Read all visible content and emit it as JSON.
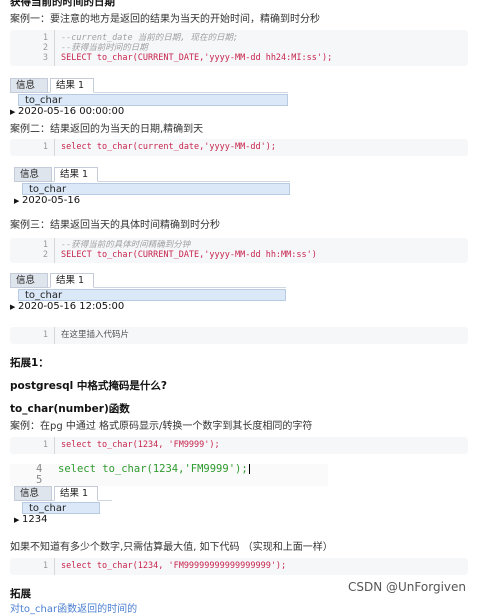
{
  "heading_top": "获得当前的时间的日期",
  "case1_text": "案例一：要注意的地方是返回的结果为当天的开始时间，精确到时分秒",
  "code1": {
    "lines": [
      {
        "n": "1",
        "text": "--current_date 当前的日期, 现在的日期;",
        "kind": "cmt"
      },
      {
        "n": "2",
        "text": "--获得当前时间的日期",
        "kind": "cmt"
      },
      {
        "n": "3",
        "text": "SELECT to_char(CURRENT_DATE,'yyyy-MM-dd hh24:MI:ss');",
        "kind": "src"
      }
    ]
  },
  "result1": {
    "tab_info": "信息",
    "tab_result": "结果 1",
    "column": "to_char",
    "value": "2020-05-16 00:00:00"
  },
  "case2_text": "案例二：结果返回的为当天的日期,精确到天",
  "code2": {
    "lines": [
      {
        "n": "1",
        "text": "select to_char(current_date,'yyyy-MM-dd');",
        "kind": "src"
      }
    ]
  },
  "result2": {
    "tab_info": "信息",
    "tab_result": "结果 1",
    "column": "to_char",
    "value": "2020-05-16"
  },
  "case3_text": "案例三：结果返回当天的具体时间精确到时分秒",
  "code3": {
    "lines": [
      {
        "n": "1",
        "text": "--获得当前的具体时间精确到分钟",
        "kind": "cmt"
      },
      {
        "n": "2",
        "text": "SELECT to_char(CURRENT_DATE,'yyyy-MM-dd hh:MM:ss')",
        "kind": "src"
      }
    ]
  },
  "result3": {
    "tab_info": "信息",
    "tab_result": "结果 1",
    "column": "to_char",
    "value": "2020-05-16 12:05:00"
  },
  "code4": {
    "lines": [
      {
        "n": "1",
        "text": "在这里插入代码片",
        "kind": "plain"
      }
    ]
  },
  "ext1_heading": "拓展1：",
  "question_heading": "postgresql 中格式掩码是什么?",
  "func_heading": "to_char(number)函数",
  "case_pg_text": "案例：在pg 中通过 格式原码显示/转换一个数字到其长度相同的字符",
  "code5": {
    "lines": [
      {
        "n": "1",
        "text": "select to_char(1234, 'FM9999');",
        "kind": "src"
      }
    ]
  },
  "screenshot_code": {
    "lines": [
      {
        "n": "4",
        "keyword": "select",
        "rest": " to_char(1234,'FM9999');"
      },
      {
        "n": "5",
        "keyword": "",
        "rest": ""
      }
    ]
  },
  "result4": {
    "tab_info": "信息",
    "tab_result": "结果 1",
    "column": "to_char",
    "value": "1234"
  },
  "estimate_text": "如果不知道有多少个数字,只需估算最大值, 如下代码 （实现和上面一样）",
  "code6": {
    "lines": [
      {
        "n": "1",
        "text": "select to_char(1234, 'FM99999999999999999');",
        "kind": "src"
      }
    ]
  },
  "ext_heading": "拓展",
  "link_text": "对to_char函数返回的时间的",
  "watermark": "CSDN @UnForgiven",
  "colors": {
    "keyword": "#c7254e",
    "comment": "#a0a0a0",
    "green": "#2e9b2e",
    "link": "#4a7fd0"
  }
}
